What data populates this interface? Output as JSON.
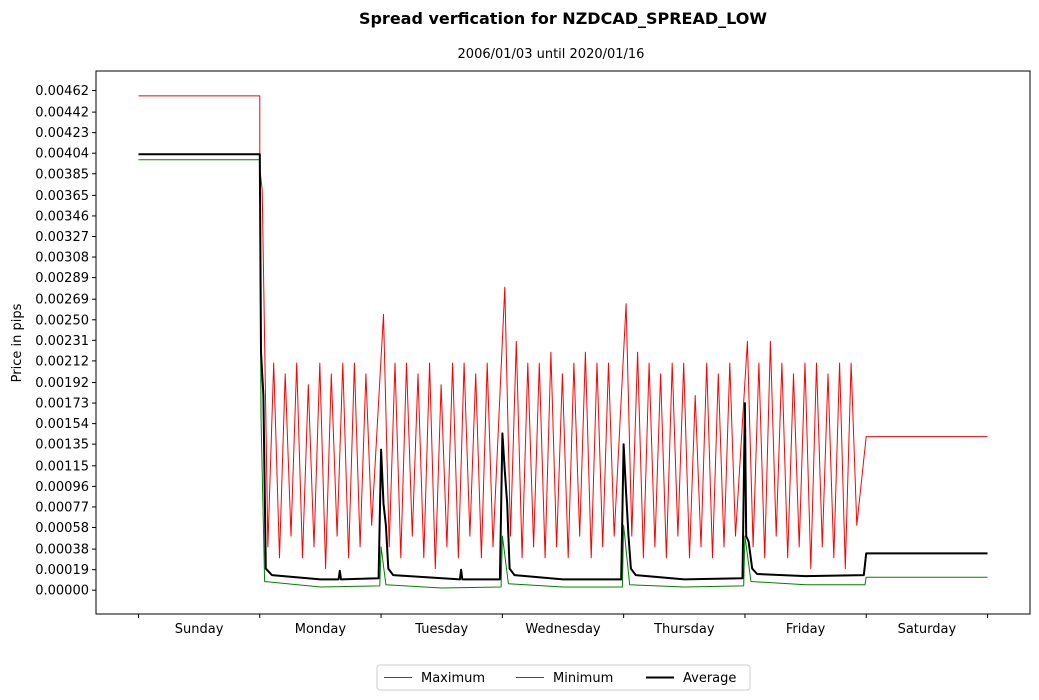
{
  "chart_data": {
    "type": "line",
    "title": "Spread verfication for NZDCAD_SPREAD_LOW",
    "subtitle": "2006/01/03 until 2020/01/16",
    "xlabel": "",
    "ylabel": "Price in pips",
    "xlim": [
      -0.35,
      7.35
    ],
    "ylim": [
      -0.00022,
      0.0048
    ],
    "grid": false,
    "legend_position": "bottom-center",
    "x_ticks": [
      0,
      1,
      2,
      3,
      4,
      5,
      6,
      7
    ],
    "x_tick_labels": [
      "Sunday",
      "Monday",
      "Tuesday",
      "Wednesday",
      "Thursday",
      "Friday",
      "Saturday"
    ],
    "y_ticks": [
      "0.00000",
      "0.00019",
      "0.00038",
      "0.00058",
      "0.00077",
      "0.00096",
      "0.00115",
      "0.00135",
      "0.00154",
      "0.00173",
      "0.00192",
      "0.00212",
      "0.00231",
      "0.00250",
      "0.00269",
      "0.00289",
      "0.00308",
      "0.00327",
      "0.00346",
      "0.00365",
      "0.00385",
      "0.00404",
      "0.00423",
      "0.00442",
      "0.00462"
    ],
    "series": [
      {
        "name": "Maximum",
        "color": "#ff0000",
        "width": 1,
        "points_head": [
          [
            0,
            0.00457
          ],
          [
            1,
            0.00457
          ],
          [
            1.0,
            0.0039
          ]
        ],
        "weekday_blocks": [
          {
            "day": 1,
            "values": [
              0.0037,
              0.0004,
              0.0021,
              0.0003,
              0.002,
              0.0005,
              0.0021,
              0.0003,
              0.0019,
              0.0004,
              0.0021,
              0.0002,
              0.002,
              0.0005,
              0.0021,
              0.0003,
              0.0021,
              0.0004,
              0.002,
              0.0006
            ]
          },
          {
            "day": 2,
            "values": [
              0.00255,
              0.0004,
              0.0021,
              0.0003,
              0.0021,
              0.0005,
              0.002,
              0.0003,
              0.0021,
              0.0002,
              0.0019,
              0.0004,
              0.0021,
              0.0003,
              0.0021,
              0.0005,
              0.002,
              0.0003,
              0.0021,
              0.0004
            ]
          },
          {
            "day": 3,
            "values": [
              0.0028,
              0.0005,
              0.0023,
              0.0003,
              0.0021,
              0.0004,
              0.0021,
              0.0003,
              0.0022,
              0.0004,
              0.002,
              0.0003,
              0.0021,
              0.0005,
              0.0022,
              0.0003,
              0.0021,
              0.0004,
              0.0021,
              0.0005
            ]
          },
          {
            "day": 4,
            "values": [
              0.00265,
              0.0005,
              0.0022,
              0.0003,
              0.0021,
              0.0004,
              0.002,
              0.0003,
              0.0021,
              0.0005,
              0.0021,
              0.0003,
              0.0018,
              0.0004,
              0.0021,
              0.0003,
              0.002,
              0.0004,
              0.0021,
              0.0005
            ]
          },
          {
            "day": 5,
            "values": [
              0.0023,
              0.0004,
              0.0021,
              0.0003,
              0.0023,
              0.0005,
              0.0021,
              0.0003,
              0.002,
              0.0004,
              0.0021,
              0.0002,
              0.0021,
              0.0004,
              0.002,
              0.0003,
              0.0021,
              0.0002,
              0.0021,
              0.0006
            ]
          }
        ],
        "points_tail": [
          [
            6,
            0.00142
          ],
          [
            7,
            0.00142
          ]
        ]
      },
      {
        "name": "Minimum",
        "color": "#008000",
        "width": 1,
        "points": [
          [
            0,
            0.00398
          ],
          [
            1,
            0.00398
          ],
          [
            1.01,
            0.0016
          ],
          [
            1.04,
            8e-05
          ],
          [
            1.5,
            3e-05
          ],
          [
            1.99,
            4e-05
          ],
          [
            2.0,
            0.0004
          ],
          [
            2.04,
            5e-05
          ],
          [
            2.5,
            2e-05
          ],
          [
            2.99,
            3e-05
          ],
          [
            3.0,
            0.0005
          ],
          [
            3.05,
            6e-05
          ],
          [
            3.5,
            3e-05
          ],
          [
            3.99,
            3e-05
          ],
          [
            4.0,
            0.0006
          ],
          [
            4.05,
            5e-05
          ],
          [
            4.5,
            3e-05
          ],
          [
            4.99,
            4e-05
          ],
          [
            5.0,
            0.0005
          ],
          [
            5.05,
            8e-05
          ],
          [
            5.5,
            5e-05
          ],
          [
            5.99,
            5e-05
          ],
          [
            6.0,
            0.00012
          ],
          [
            7,
            0.00012
          ]
        ]
      },
      {
        "name": "Average",
        "color": "#000000",
        "width": 2,
        "points": [
          [
            0,
            0.00403
          ],
          [
            1,
            0.00403
          ],
          [
            1.01,
            0.0022
          ],
          [
            1.03,
            0.0018
          ],
          [
            1.05,
            0.0002
          ],
          [
            1.1,
            0.00014
          ],
          [
            1.5,
            0.0001
          ],
          [
            1.65,
            0.0001
          ],
          [
            1.66,
            0.00018
          ],
          [
            1.67,
            0.0001
          ],
          [
            1.98,
            0.00011
          ],
          [
            2.0,
            0.0013
          ],
          [
            2.02,
            0.0008
          ],
          [
            2.04,
            0.0006
          ],
          [
            2.06,
            0.0002
          ],
          [
            2.1,
            0.00014
          ],
          [
            2.65,
            0.0001
          ],
          [
            2.66,
            0.00019
          ],
          [
            2.67,
            0.0001
          ],
          [
            2.98,
            0.0001
          ],
          [
            3.0,
            0.00145
          ],
          [
            3.02,
            0.0011
          ],
          [
            3.04,
            0.0008
          ],
          [
            3.06,
            0.0002
          ],
          [
            3.1,
            0.00014
          ],
          [
            3.5,
            0.0001
          ],
          [
            3.98,
            0.0001
          ],
          [
            4.0,
            0.00135
          ],
          [
            4.02,
            0.0009
          ],
          [
            4.04,
            0.0005
          ],
          [
            4.06,
            0.0002
          ],
          [
            4.1,
            0.00014
          ],
          [
            4.5,
            0.0001
          ],
          [
            4.98,
            0.00011
          ],
          [
            5.0,
            0.00173
          ],
          [
            5.01,
            0.0005
          ],
          [
            5.03,
            0.00045
          ],
          [
            5.06,
            0.0002
          ],
          [
            5.1,
            0.00015
          ],
          [
            5.5,
            0.00013
          ],
          [
            5.98,
            0.00014
          ],
          [
            6.0,
            0.00034
          ],
          [
            7,
            0.00034
          ]
        ]
      }
    ]
  }
}
